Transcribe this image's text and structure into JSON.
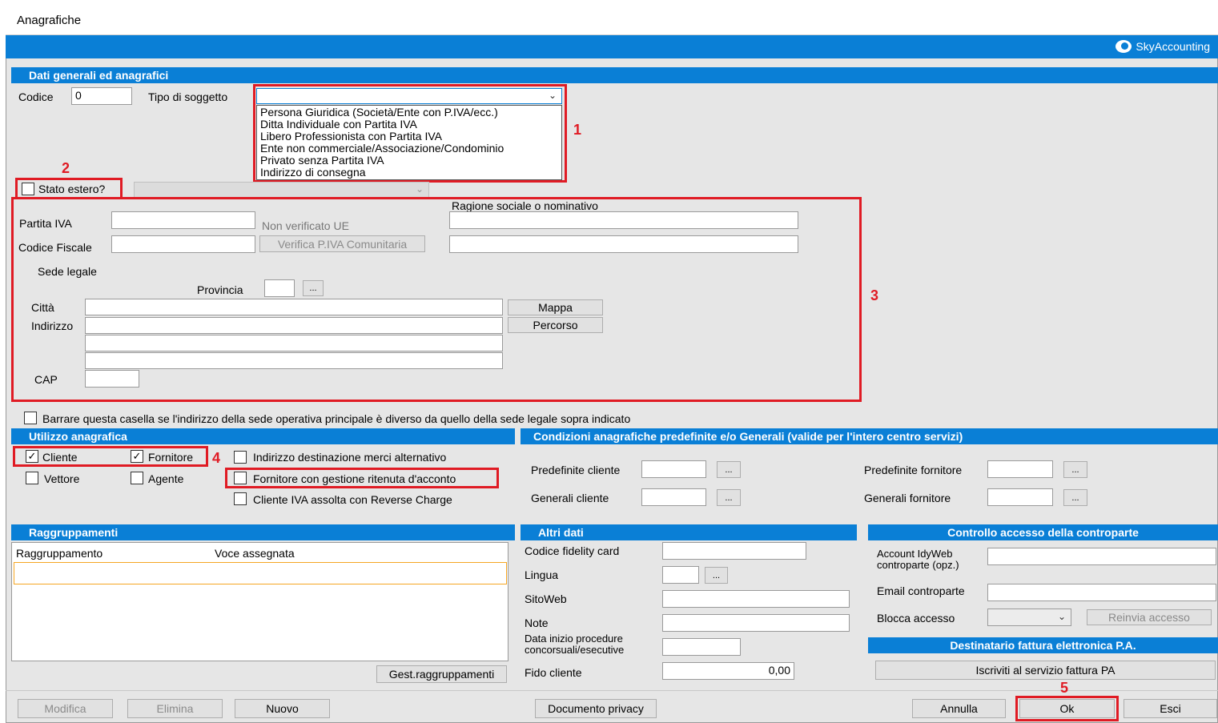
{
  "window": {
    "title": "Anagrafiche",
    "brand": "SkyAccounting",
    "brand_icon": "skyaccounting-logo-icon"
  },
  "sections": {
    "general": "Dati generali ed anagrafici",
    "usage": "Utilizzo anagrafica",
    "conditions": "Condizioni anagrafiche predefinite e/o Generali (valide per l'intero centro servizi)",
    "groupings": "Raggruppamenti",
    "other": "Altri dati",
    "access": "Controllo accesso della controparte",
    "einvoice": "Destinatario fattura elettronica P.A."
  },
  "general": {
    "codice_label": "Codice",
    "codice_value": "0",
    "tipo_label": "Tipo di soggetto",
    "tipo_value": "",
    "tipo_options": [
      "Persona Giuridica (Società/Ente con P.IVA/ecc.)",
      "Ditta Individuale con Partita IVA",
      "Libero Professionista con Partita IVA",
      "Ente non commerciale/Associazione/Condominio",
      "Privato senza Partita IVA",
      "Indirizzo di consegna"
    ],
    "stato_estero_label": "Stato estero?",
    "stato_estero_checked": false,
    "ragione_label": "Ragione sociale o nominativo",
    "piva_label": "Partita IVA",
    "non_verificato": "Non verificato UE",
    "cf_label": "Codice Fiscale",
    "verifica_button": "Verifica P.IVA Comunitaria",
    "sede_legale": "Sede legale",
    "provincia_label": "Provincia",
    "ellipsis": "...",
    "citta_label": "Città",
    "indirizzo_label": "Indirizzo",
    "cap_label": "CAP",
    "mappa_button": "Mappa",
    "percorso_button": "Percorso",
    "sede_diversa_label": "Barrare questa casella se l'indirizzo della sede operativa principale è diverso da quello della sede legale sopra indicato"
  },
  "usage": {
    "cliente": {
      "label": "Cliente",
      "checked": true
    },
    "fornitore": {
      "label": "Fornitore",
      "checked": true
    },
    "vettore": {
      "label": "Vettore",
      "checked": false
    },
    "agente": {
      "label": "Agente",
      "checked": false
    },
    "indirizzo_alt": {
      "label": "Indirizzo destinazione merci alternativo",
      "checked": false
    },
    "ritenuta": {
      "label": "Fornitore con gestione ritenuta d'acconto",
      "checked": false
    },
    "reverse": {
      "label": "Cliente IVA assolta con Reverse Charge",
      "checked": false
    }
  },
  "conditions": {
    "pred_cliente": "Predefinite cliente",
    "gen_cliente": "Generali cliente",
    "pred_fornitore": "Predefinite fornitore",
    "gen_fornitore": "Generali fornitore"
  },
  "groupings": {
    "columns": [
      "Raggruppamento",
      "Voce assegnata"
    ],
    "gest_button": "Gest.raggruppamenti"
  },
  "other": {
    "fidelity": "Codice fidelity card",
    "lingua": "Lingua",
    "sitoweb": "SitoWeb",
    "note": "Note",
    "data_inizio": "Data inizio procedure concorsuali/esecutive",
    "fido": "Fido cliente",
    "fido_value": "0,00"
  },
  "access": {
    "account": "Account IdyWeb controparte (opz.)",
    "email": "Email controparte",
    "blocca": "Blocca accesso",
    "reinvia": "Reinvia accesso"
  },
  "einvoice": {
    "iscriviti": "Iscriviti al servizio fattura PA"
  },
  "footer": {
    "modifica": "Modifica",
    "elimina": "Elimina",
    "nuovo": "Nuovo",
    "privacy": "Documento privacy",
    "annulla": "Annulla",
    "ok": "Ok",
    "esci": "Esci"
  },
  "annotations": [
    "1",
    "2",
    "3",
    "4",
    "5"
  ],
  "colors": {
    "accent": "#0a7fd6",
    "annotation": "#e01b24",
    "background": "#e6e6e6"
  }
}
